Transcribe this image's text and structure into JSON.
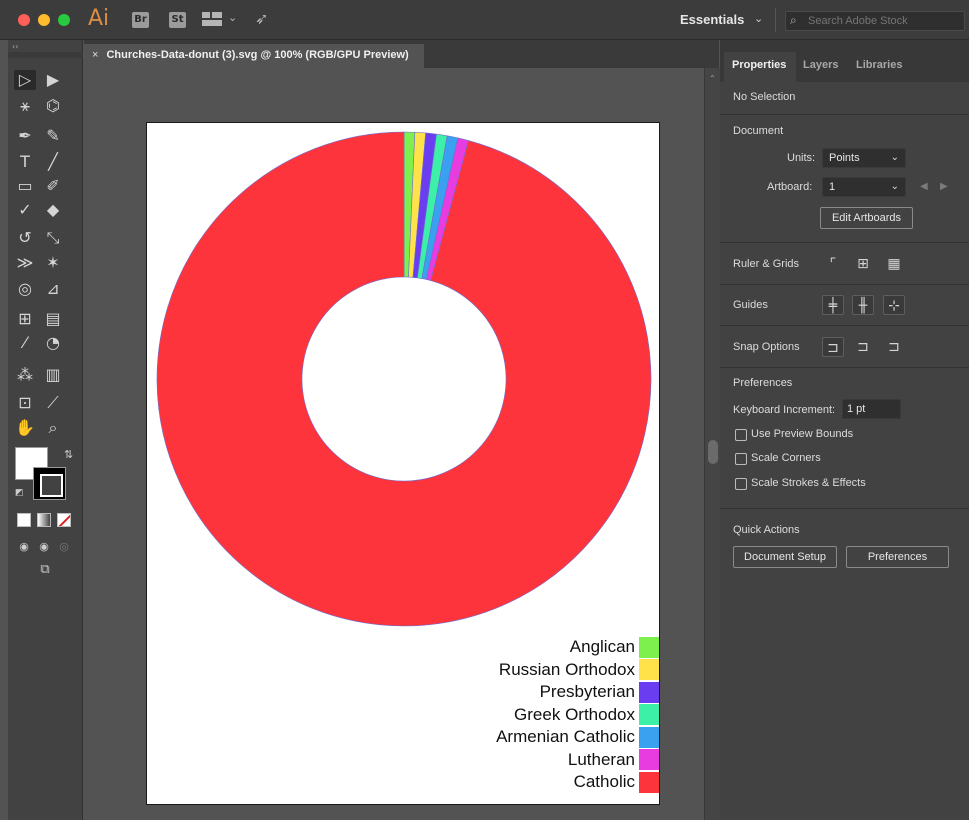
{
  "app": {
    "logo": "Ai",
    "badges": [
      "Br",
      "St"
    ],
    "workspace_label": "Essentials",
    "stock_search_placeholder": "Search Adobe Stock"
  },
  "document": {
    "tab_title": "Churches-Data-donut (3).svg @ 100% (RGB/GPU Preview)"
  },
  "chart_data": {
    "type": "pie",
    "categories": [
      "Anglican",
      "Russian Orthodox",
      "Presbyterian",
      "Greek Orthodox",
      "Armenian Catholic",
      "Lutheran",
      "Catholic"
    ],
    "values": [
      0.7,
      0.7,
      0.7,
      0.7,
      0.7,
      0.7,
      95.8
    ],
    "colors": [
      "#7ef04e",
      "#ffe24a",
      "#6a3df0",
      "#3cf0a8",
      "#3aa0f0",
      "#e83ce0",
      "#fe343c"
    ],
    "donut": true,
    "legend_position": "bottom-right"
  },
  "panel": {
    "tabs": [
      "Properties",
      "Layers",
      "Libraries"
    ],
    "selection": "No Selection",
    "document_heading": "Document",
    "units_label": "Units:",
    "units_value": "Points",
    "artboard_label": "Artboard:",
    "artboard_value": "1",
    "edit_artboards": "Edit Artboards",
    "ruler_grids": "Ruler & Grids",
    "guides": "Guides",
    "snap_options": "Snap Options",
    "preferences_heading": "Preferences",
    "keyboard_increment_label": "Keyboard Increment:",
    "keyboard_increment_value": "1 pt",
    "checkboxes": [
      "Use Preview Bounds",
      "Scale Corners",
      "Scale Strokes & Effects"
    ],
    "quick_actions": "Quick Actions",
    "document_setup": "Document Setup",
    "preferences_button": "Preferences"
  },
  "colors": {
    "accent_logo": "#d98e47",
    "panel_bg": "#424242",
    "canvas_bg": "#535353"
  }
}
